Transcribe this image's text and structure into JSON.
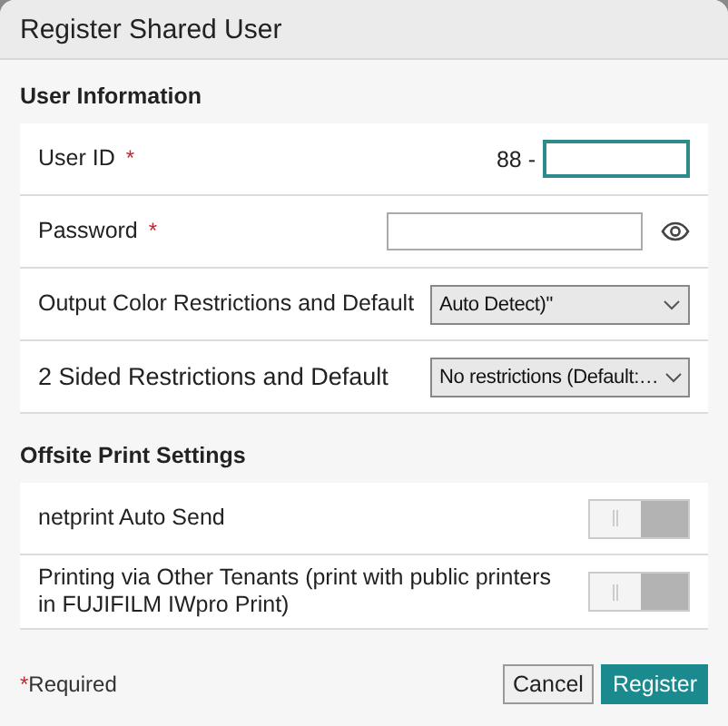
{
  "dialog": {
    "title": "Register Shared User"
  },
  "sections": [
    {
      "title": "User Information",
      "rows": [
        {
          "kind": "prefixed",
          "label": "User ID",
          "required_mark": "*",
          "prefix": "88 -",
          "focused": true
        },
        {
          "kind": "password",
          "label": "Password",
          "required_mark": "*"
        },
        {
          "kind": "select",
          "label": "Output Color Restrictions and Default",
          "value": "Auto Detect)\""
        },
        {
          "kind": "select",
          "label": "2 Sided Restrictions and Default",
          "value": "No restrictions (Default:…"
        }
      ]
    },
    {
      "title": "Offsite Print Settings",
      "rows": [
        {
          "kind": "toggle",
          "label": "netprint Auto Send",
          "on": false
        },
        {
          "kind": "toggle",
          "label": "Printing via Other Tenants (print with public printers in FUJIFILM IWpro Print)",
          "on": false
        }
      ]
    }
  ],
  "footer": {
    "required_mark": "*",
    "required_text": "Required",
    "buttons": [
      {
        "label": "Cancel",
        "kind": "secondary"
      },
      {
        "label": "Register",
        "kind": "primary"
      }
    ]
  }
}
